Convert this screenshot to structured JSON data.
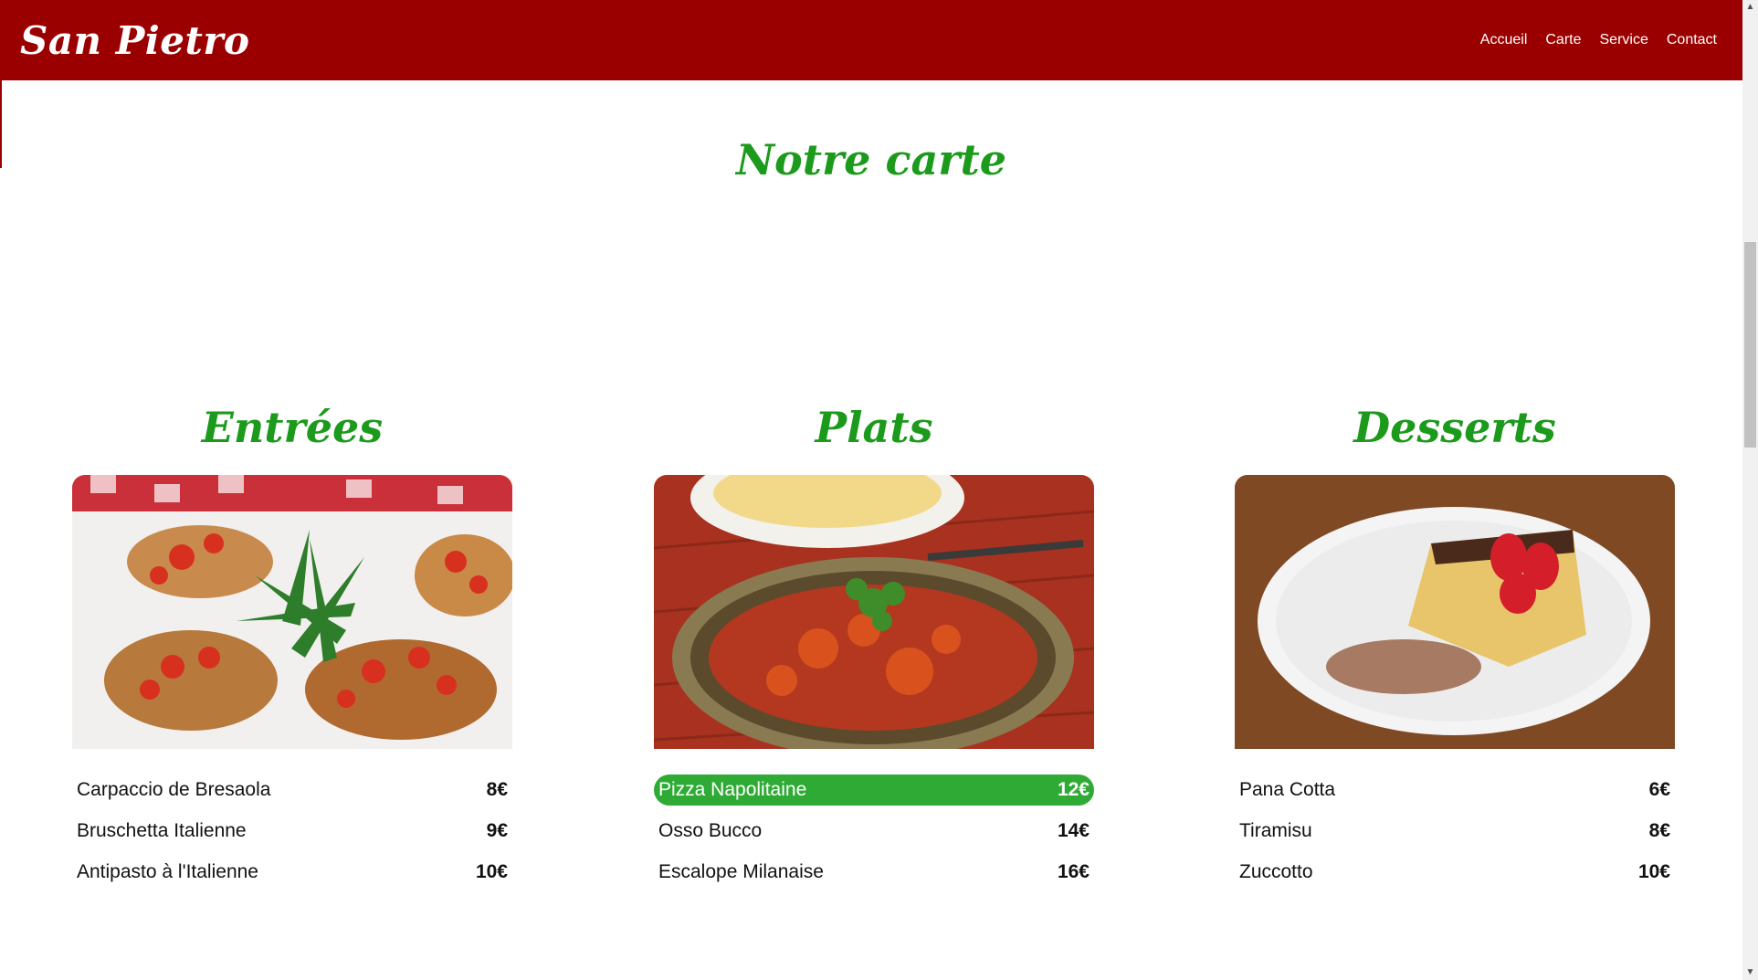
{
  "header": {
    "brand": "San Pietro",
    "nav": [
      "Accueil",
      "Carte",
      "Service",
      "Contact"
    ]
  },
  "page_title": "Notre carte",
  "sections": [
    {
      "title": "Entrées",
      "image_icon": "bruschetta-photo",
      "items": [
        {
          "name": "Carpaccio de Bresaola",
          "price": "8€"
        },
        {
          "name": "Bruschetta Italienne",
          "price": "9€"
        },
        {
          "name": "Antipasto à l'Italienne",
          "price": "10€"
        }
      ]
    },
    {
      "title": "Plats",
      "image_icon": "stew-pasta-photo",
      "items": [
        {
          "name": "Pizza Napolitaine",
          "price": "12€"
        },
        {
          "name": "Osso Bucco",
          "price": "14€"
        },
        {
          "name": "Escalope Milanaise",
          "price": "16€"
        }
      ]
    },
    {
      "title": "Desserts",
      "image_icon": "tiramisu-photo",
      "items": [
        {
          "name": "Pana Cotta",
          "price": "6€"
        },
        {
          "name": "Tiramisu",
          "price": "8€"
        },
        {
          "name": "Zuccotto",
          "price": "10€"
        }
      ]
    }
  ],
  "colors": {
    "header_bg": "#9b0000",
    "title_green": "#1c9a1c",
    "highlight_green": "#2fab35"
  }
}
